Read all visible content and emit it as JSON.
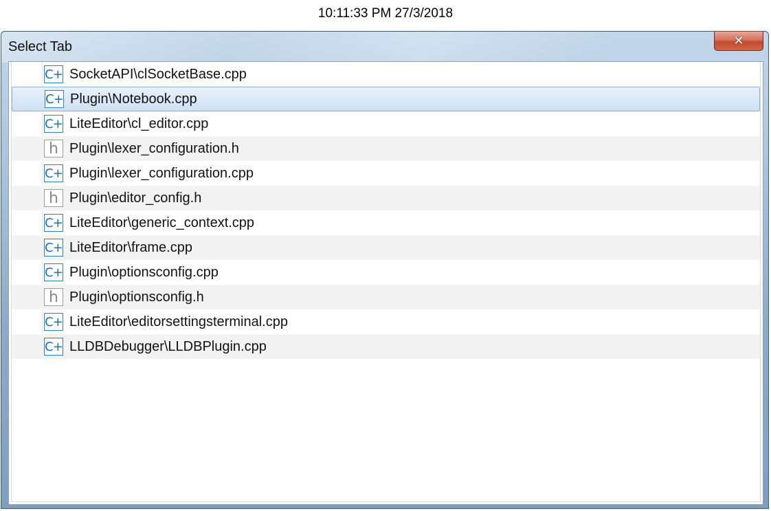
{
  "timestamp": "10:11:33 PM 27/3/2018",
  "window": {
    "title": "Select Tab",
    "close_label": "✕"
  },
  "tabs": [
    {
      "icon": "cpp",
      "icon_text": "C+",
      "label": "SocketAPI\\clSocketBase.cpp",
      "selected": false
    },
    {
      "icon": "cpp",
      "icon_text": "C+",
      "label": "Plugin\\Notebook.cpp",
      "selected": true
    },
    {
      "icon": "cpp",
      "icon_text": "C+",
      "label": "LiteEditor\\cl_editor.cpp",
      "selected": false
    },
    {
      "icon": "h",
      "icon_text": "h",
      "label": "Plugin\\lexer_configuration.h",
      "selected": false
    },
    {
      "icon": "cpp",
      "icon_text": "C+",
      "label": "Plugin\\lexer_configuration.cpp",
      "selected": false
    },
    {
      "icon": "h",
      "icon_text": "h",
      "label": "Plugin\\editor_config.h",
      "selected": false
    },
    {
      "icon": "cpp",
      "icon_text": "C+",
      "label": "LiteEditor\\generic_context.cpp",
      "selected": false
    },
    {
      "icon": "cpp",
      "icon_text": "C+",
      "label": "LiteEditor\\frame.cpp",
      "selected": false
    },
    {
      "icon": "cpp",
      "icon_text": "C+",
      "label": "Plugin\\optionsconfig.cpp",
      "selected": false
    },
    {
      "icon": "h",
      "icon_text": "h",
      "label": "Plugin\\optionsconfig.h",
      "selected": false
    },
    {
      "icon": "cpp",
      "icon_text": "C+",
      "label": "LiteEditor\\editorsettingsterminal.cpp",
      "selected": false
    },
    {
      "icon": "cpp",
      "icon_text": "C+",
      "label": "LLDBDebugger\\LLDBPlugin.cpp",
      "selected": false
    }
  ],
  "colors": {
    "selection": "#cfe0f5",
    "cpp_icon": "#2a82c4",
    "h_icon": "#9a9a9a",
    "close_button": "#c14a2f"
  }
}
